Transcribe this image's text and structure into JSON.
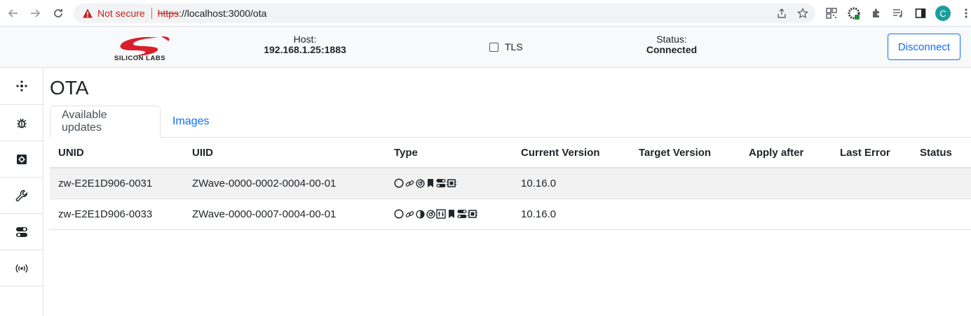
{
  "browser": {
    "not_secure": "Not secure",
    "url_scheme": "https",
    "url_rest": "://localhost:3000/ota",
    "profile_initial": "C"
  },
  "header": {
    "logo_text": "SILICON LABS",
    "host_label": "Host:",
    "host_value": "192.168.1.25:1883",
    "tls_label": "TLS",
    "status_label": "Status:",
    "status_value": "Connected",
    "disconnect_label": "Disconnect"
  },
  "sidebar": {
    "items": [
      "network-icon",
      "bug-icon",
      "settings-box-icon",
      "wrench-icon",
      "toggles-icon",
      "broadcast-icon"
    ]
  },
  "page": {
    "title": "OTA",
    "tabs": [
      "Available updates",
      "Images"
    ]
  },
  "table": {
    "columns": [
      "UNID",
      "UIID",
      "Type",
      "Current Version",
      "Target Version",
      "Apply after",
      "Last Error",
      "Status"
    ],
    "rows": [
      {
        "unid": "zw-E2E1D906-0031",
        "uiid": "ZWave-0000-0002-0004-00-01",
        "version": "10.16.0",
        "type_icons": [
          "circle-icon",
          "link-icon",
          "dial-icon",
          "bookmark-icon",
          "toggles-icon",
          "chip-icon"
        ]
      },
      {
        "unid": "zw-E2E1D906-0033",
        "uiid": "ZWave-0000-0007-0004-00-01",
        "version": "10.16.0",
        "type_icons": [
          "circle-icon",
          "link-icon",
          "contrast-icon",
          "dial-icon",
          "thermostat-icon",
          "bookmark-icon",
          "toggles-icon",
          "chip-icon"
        ]
      }
    ]
  },
  "colors": {
    "accent": "#0d6efd",
    "danger": "#c5221f",
    "profile": "#1a9e9e"
  }
}
